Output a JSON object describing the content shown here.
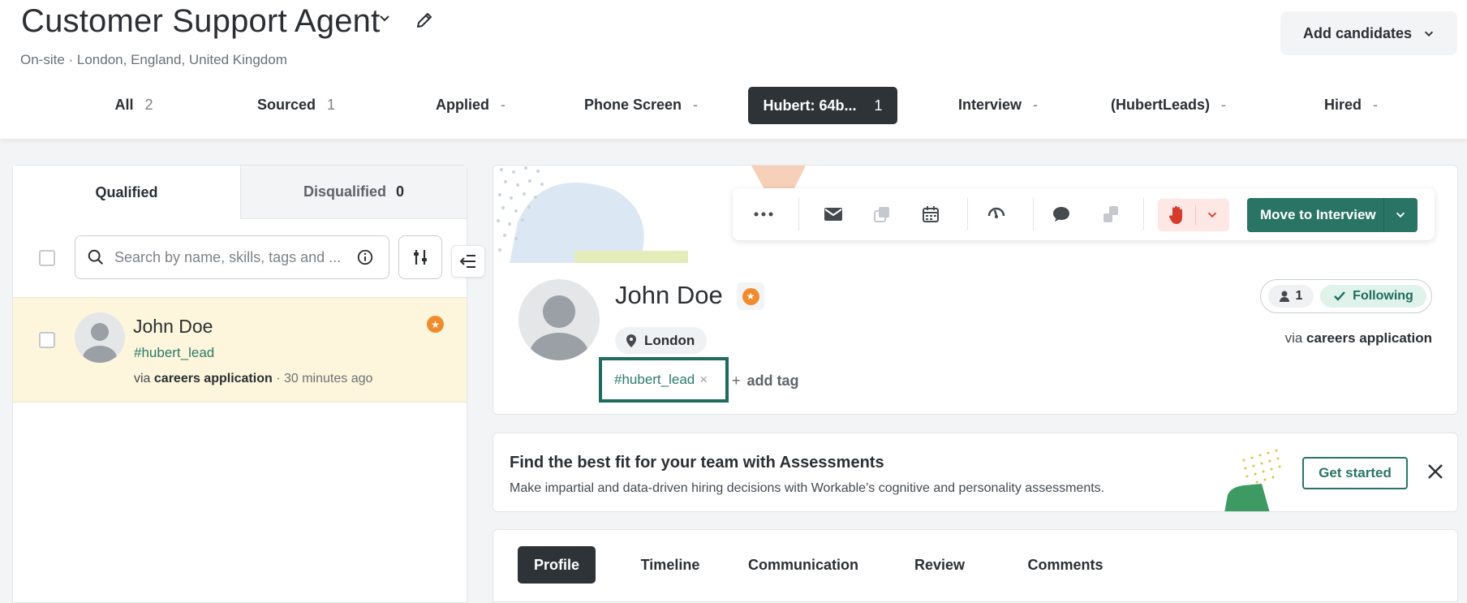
{
  "job": {
    "title": "Customer Support Agent",
    "subtitle": "On-site · London, England, United Kingdom",
    "add_candidates": "Add candidates"
  },
  "stages": [
    {
      "label": "All",
      "count": "2"
    },
    {
      "label": "Sourced",
      "count": "1"
    },
    {
      "label": "Applied",
      "count": "-"
    },
    {
      "label": "Phone Screen",
      "count": "-"
    },
    {
      "label": "Hubert: 64b...",
      "count": "1"
    },
    {
      "label": "Interview",
      "count": "-"
    },
    {
      "label": "(HubertLeads)",
      "count": "-"
    },
    {
      "label": "Hired",
      "count": "-"
    }
  ],
  "left": {
    "tab_qualified": "Qualified",
    "tab_disqualified": "Disqualified",
    "disqualified_count": "0",
    "search_placeholder": "Search by name, skills, tags and ...",
    "candidate": {
      "name": "John Doe",
      "tag": "#hubert_lead",
      "via_prefix": "via",
      "source": "careers application",
      "ago": "· 30 minutes ago"
    }
  },
  "profile": {
    "name": "John Doe",
    "location": "London",
    "tag": "#hubert_lead",
    "add_tag": "add tag",
    "followers": "1",
    "following": "Following",
    "via_prefix": "via",
    "source": "careers application",
    "move_button": "Move to Interview"
  },
  "assessments": {
    "title": "Find the best fit for your team with Assessments",
    "subtitle": "Make impartial and data-driven hiring decisions with Workable’s cognitive and personality assessments.",
    "cta": "Get started"
  },
  "profile_tabs": [
    "Profile",
    "Timeline",
    "Communication",
    "Review",
    "Comments"
  ],
  "colors": {
    "accent": "#2a7466",
    "dark": "#2e3338",
    "highlight_row": "#fdf6dc",
    "star": "#f08c2e"
  }
}
